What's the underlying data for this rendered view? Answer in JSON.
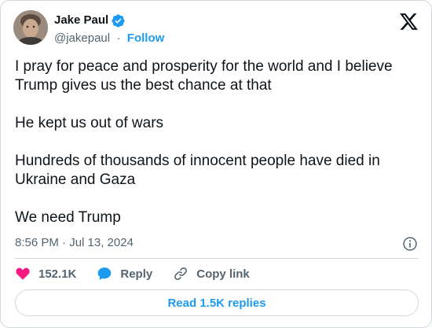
{
  "author": {
    "name": "Jake Paul",
    "handle": "@jakepaul",
    "separator": "·",
    "follow_label": "Follow",
    "avatar_icon": "profile-photo"
  },
  "tweet": {
    "paragraphs": [
      "I pray for peace and prosperity for the world and I believe Trump gives us the best chance at that",
      "He kept us out of wars",
      "Hundreds of thousands of innocent people have died in Ukraine and Gaza",
      "We need Trump"
    ],
    "timestamp": "8:56 PM · Jul 13, 2024"
  },
  "actions": {
    "like_count": "152.1K",
    "reply_label": "Reply",
    "copy_link_label": "Copy link"
  },
  "replies_button": {
    "label": "Read 1.5K replies"
  },
  "colors": {
    "accent": "#1d9bf0",
    "like": "#f91880",
    "text": "#0f1419",
    "muted": "#536471",
    "border": "#cfd9de"
  }
}
